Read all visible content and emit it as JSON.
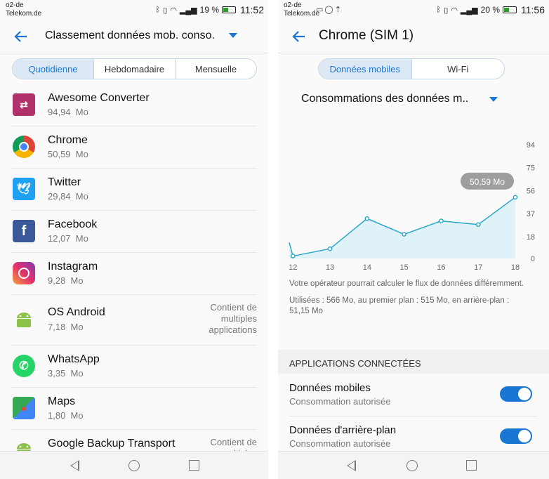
{
  "left": {
    "status": {
      "carrier_line1": "o2-de",
      "carrier_line2": "Telekom.de",
      "battery": "19 %",
      "time": "11:52"
    },
    "title": "Classement données mob. conso.",
    "tabs": [
      {
        "label": "Quotidienne",
        "active": true
      },
      {
        "label": "Hebdomadaire",
        "active": false
      },
      {
        "label": "Mensuelle",
        "active": false
      }
    ],
    "apps": [
      {
        "name": "Awesome Converter",
        "size": "94,94",
        "unit": "Mo",
        "note": "",
        "icon": "awesome-converter-icon",
        "color": "#b0306a"
      },
      {
        "name": "Chrome",
        "size": "50,59",
        "unit": "Mo",
        "note": "",
        "icon": "chrome-icon",
        "color": "#4285f4"
      },
      {
        "name": "Twitter",
        "size": "29,84",
        "unit": "Mo",
        "note": "",
        "icon": "twitter-icon",
        "color": "#1da1f2"
      },
      {
        "name": "Facebook",
        "size": "12,07",
        "unit": "Mo",
        "note": "",
        "icon": "facebook-icon",
        "color": "#3b5998"
      },
      {
        "name": "Instagram",
        "size": "9,28",
        "unit": "Mo",
        "note": "",
        "icon": "instagram-icon",
        "color": "#c13584"
      },
      {
        "name": "OS Android",
        "size": "7,18",
        "unit": "Mo",
        "note": "Contient de multiples applications",
        "icon": "android-icon",
        "color": "#8bc34a"
      },
      {
        "name": "WhatsApp",
        "size": "3,35",
        "unit": "Mo",
        "note": "",
        "icon": "whatsapp-icon",
        "color": "#25d366"
      },
      {
        "name": "Maps",
        "size": "1,80",
        "unit": "Mo",
        "note": "",
        "icon": "maps-icon",
        "color": "#34a853"
      },
      {
        "name": "Google Backup Transport",
        "size": "",
        "unit": "",
        "note": "Contient de multiples",
        "icon": "android-icon",
        "color": "#8bc34a"
      }
    ]
  },
  "right": {
    "status": {
      "carrier_line1": "o2-de",
      "carrier_line2": "Telekom.de",
      "battery": "20 %",
      "time": "11:56"
    },
    "title": "Chrome (SIM 1)",
    "tabs": [
      {
        "label": "Données mobiles",
        "active": true
      },
      {
        "label": "Wi-Fi",
        "active": false
      }
    ],
    "dropdown": "Consommations des données m..",
    "tooltip_value": "50,59",
    "tooltip_unit": "Mo",
    "note": "Votre opérateur pourrait calculer le flux de données différemment.",
    "usage_line1": "Utilisées : 566  Mo, au premier plan : 515  Mo, en arrière-plan :",
    "usage_line2": "51,15  Mo",
    "section_header": "APPLICATIONS CONNECTÉES",
    "toggles": [
      {
        "title": "Données mobiles",
        "subtitle": "Consommation autorisée",
        "on": true
      },
      {
        "title": "Données d'arrière-plan",
        "subtitle": "Consommation autorisée",
        "on": true
      }
    ]
  },
  "chart_data": {
    "type": "area",
    "x": [
      11.9,
      12,
      13,
      14,
      15,
      16,
      17,
      18
    ],
    "x_ticks": [
      "12",
      "13",
      "14",
      "15",
      "16",
      "17",
      "18"
    ],
    "y_ticks": [
      "94",
      "75",
      "56",
      "37",
      "18",
      "0"
    ],
    "values": [
      13,
      2,
      8,
      33,
      20,
      31,
      28,
      50.59
    ],
    "ylim": [
      0,
      94
    ],
    "xlim": [
      11.9,
      18
    ],
    "color": "#2aa7c9",
    "fill": "#dff2f8"
  }
}
